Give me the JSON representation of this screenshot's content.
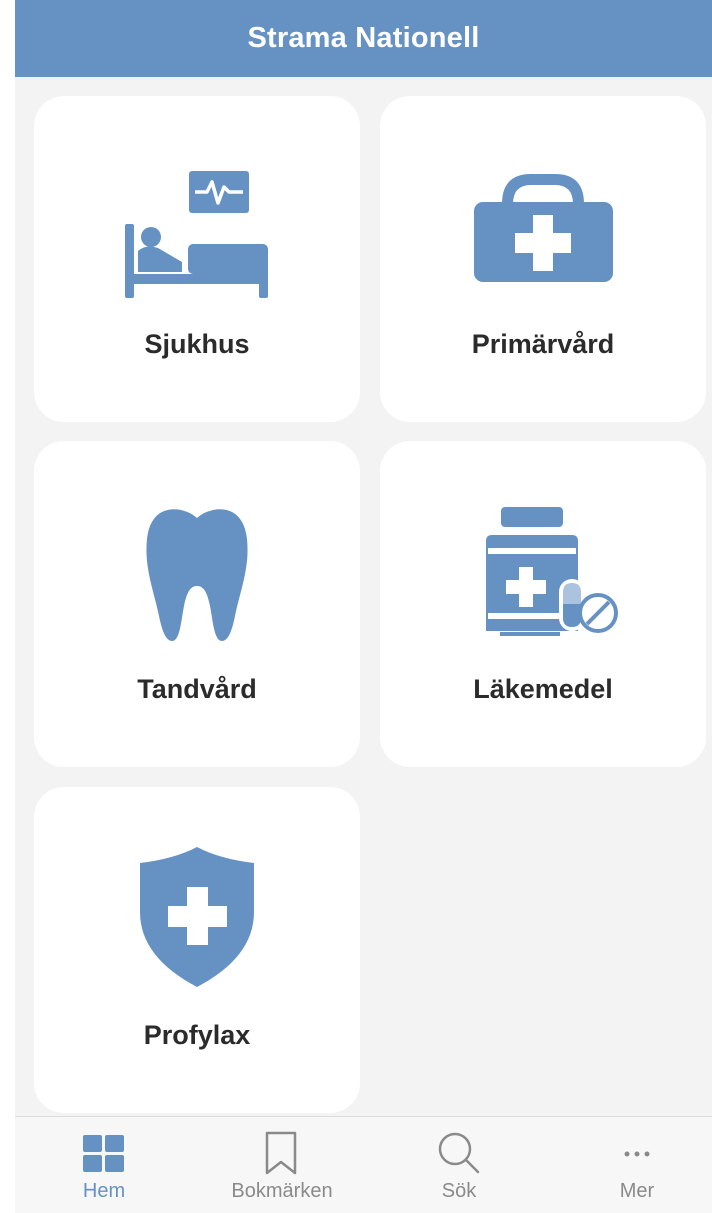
{
  "header": {
    "title": "Strama Nationell"
  },
  "colors": {
    "accent": "#6692c3",
    "background": "#f3f3f3",
    "card": "#ffffff",
    "label": "#2b2b2b",
    "tab_inactive": "#8a8a8a"
  },
  "categories": [
    {
      "label": "Sjukhus",
      "icon": "hospital-bed-icon"
    },
    {
      "label": "Primärvård",
      "icon": "medical-bag-icon"
    },
    {
      "label": "Tandvård",
      "icon": "tooth-icon"
    },
    {
      "label": "Läkemedel",
      "icon": "medicine-bottle-icon"
    },
    {
      "label": "Profylax",
      "icon": "shield-cross-icon"
    }
  ],
  "tabbar": {
    "active": "Hem",
    "tabs": [
      {
        "label": "Hem",
        "icon": "grid-icon"
      },
      {
        "label": "Bokmärken",
        "icon": "bookmark-icon"
      },
      {
        "label": "Sök",
        "icon": "search-icon"
      },
      {
        "label": "Mer",
        "icon": "more-icon"
      }
    ]
  }
}
